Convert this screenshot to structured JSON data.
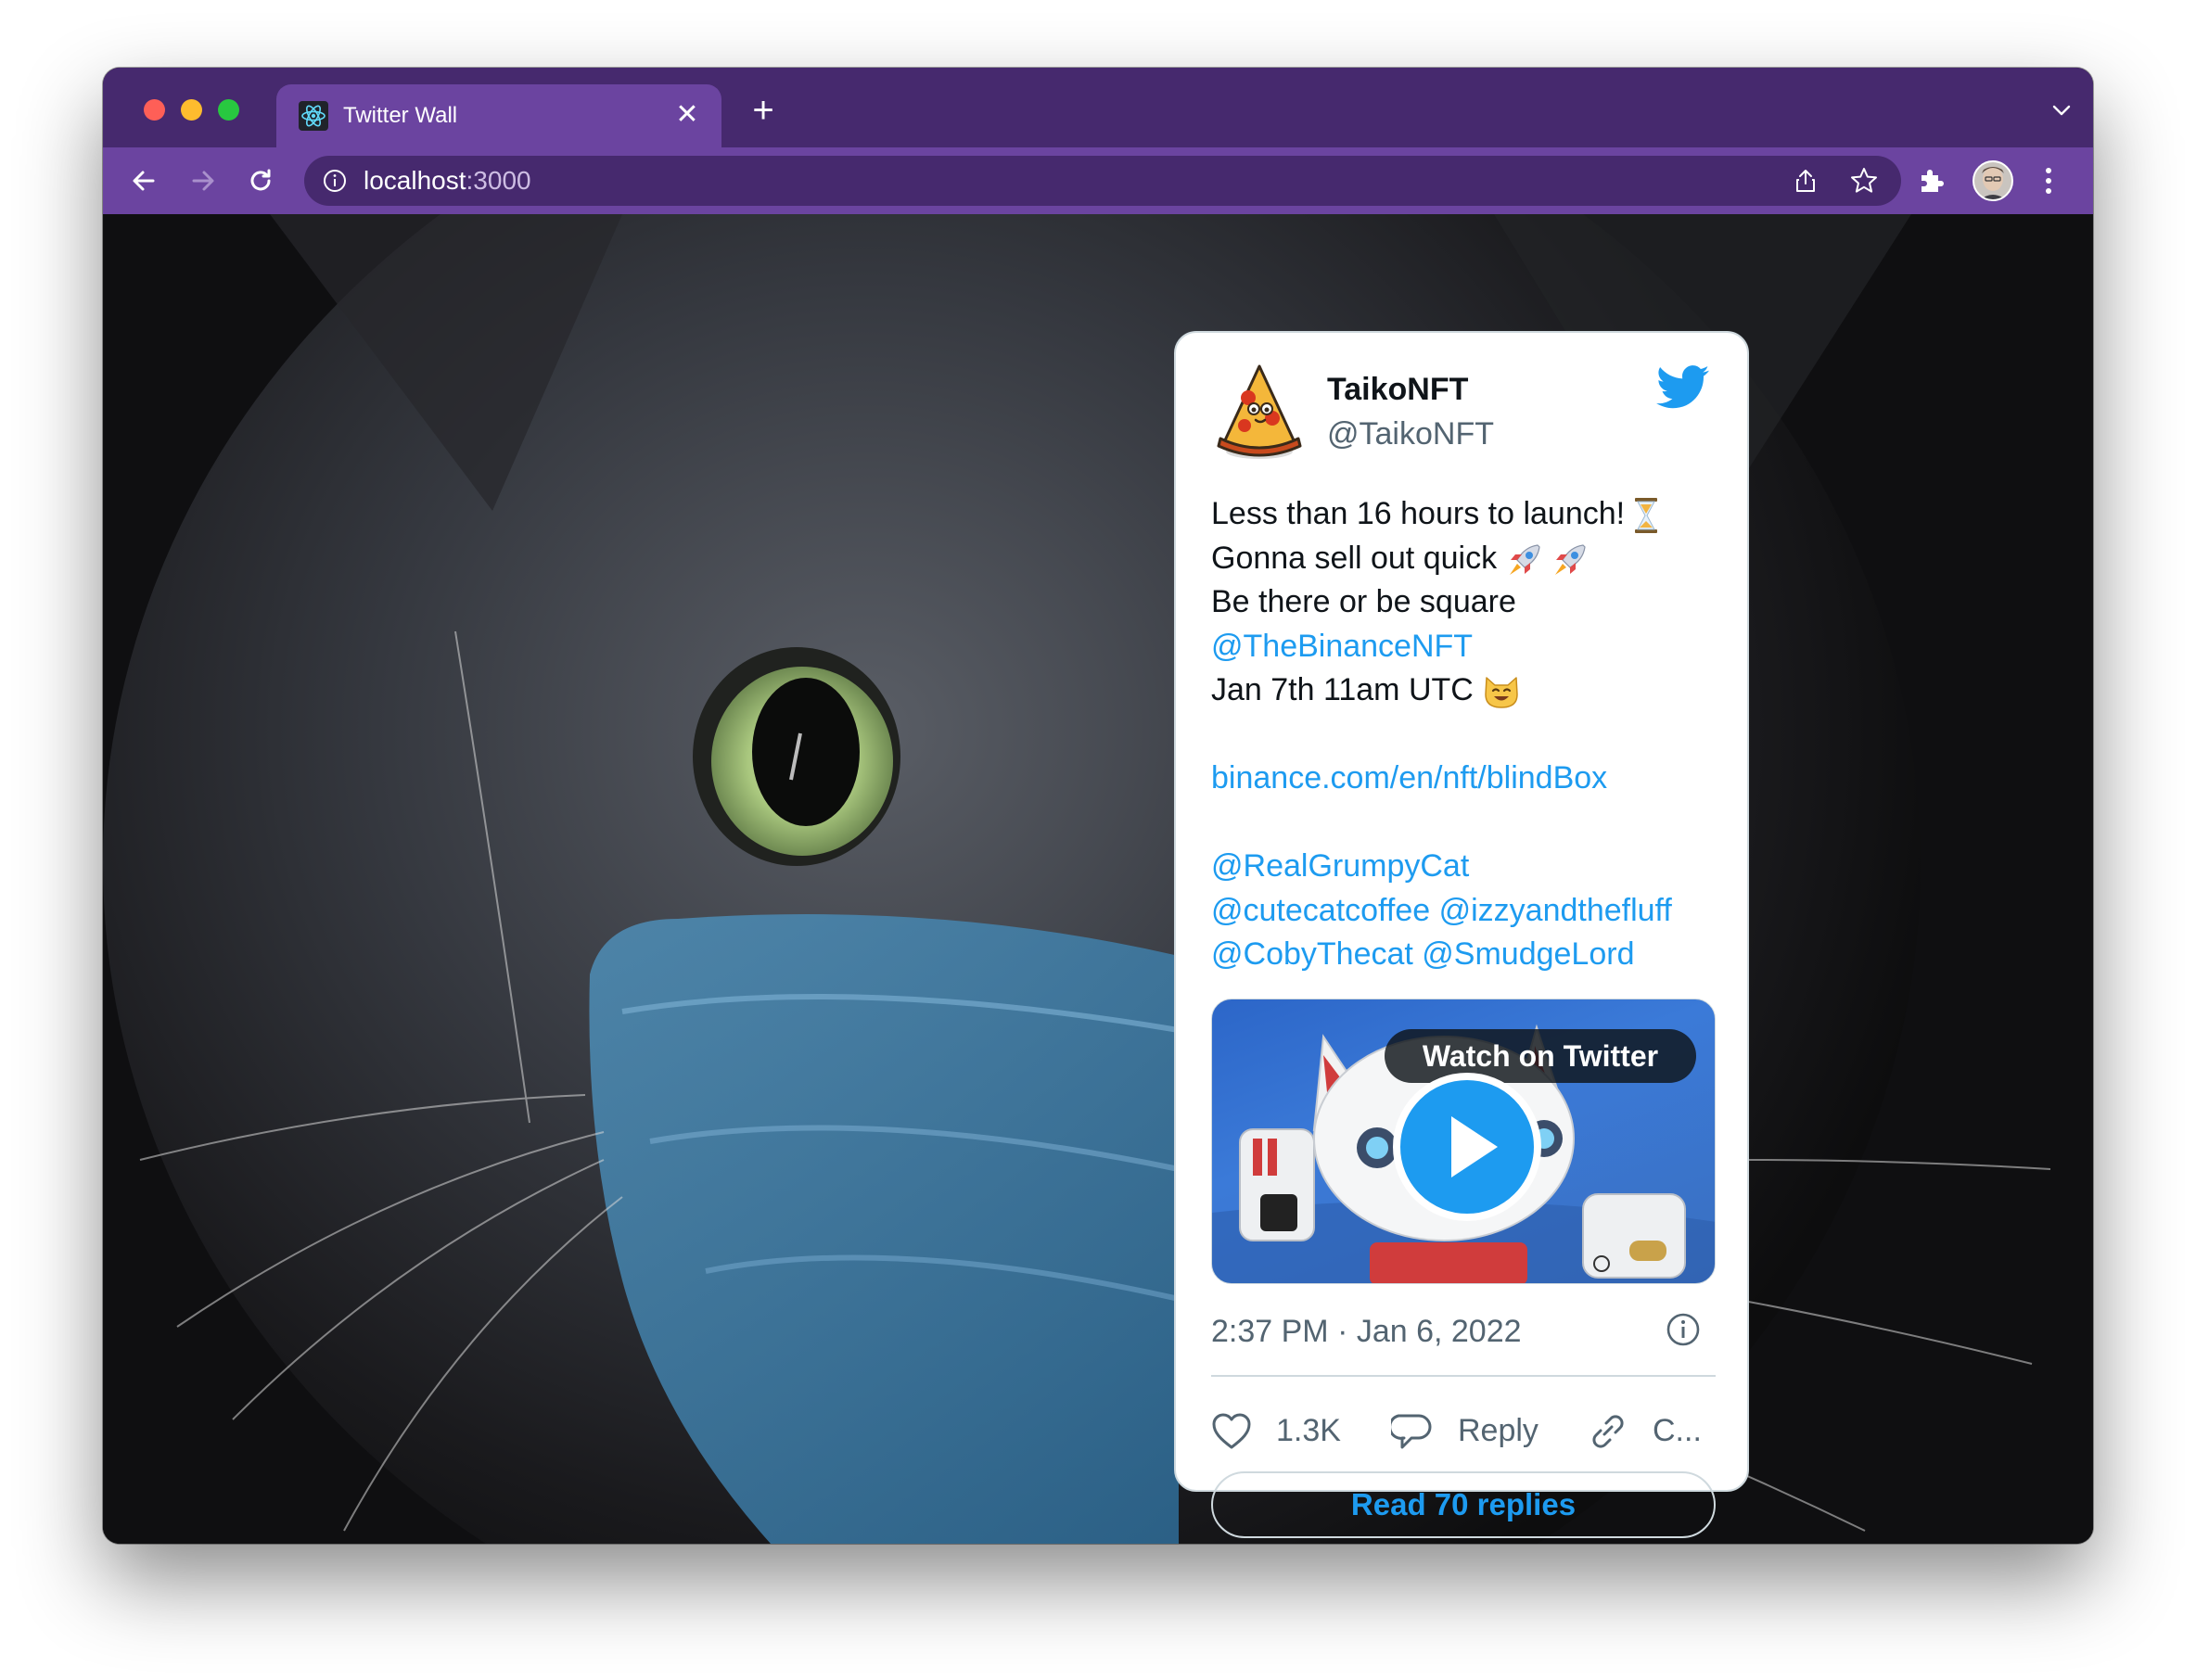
{
  "browser": {
    "tab_title": "Twitter Wall",
    "tab_close": "✕",
    "new_tab": "+",
    "url_host": "localhost",
    "url_port": ":3000"
  },
  "tweet": {
    "display_name": "TaikoNFT",
    "handle": "@TaikoNFT",
    "text_lines": [
      "Less than 16 hours to launch!",
      "Gonna sell out quick",
      "Be there or be square",
      "@TheBinanceNFT",
      "Jan 7th 11am UTC",
      "",
      "binance.com/en/nft/blindBox",
      "",
      "@RealGrumpyCat",
      "@cutecatcoffee @izzyandthefluff",
      "@CobyThecat @SmudgeLord"
    ],
    "emojis": [
      "hourglass-emoji",
      "rocket-emoji",
      "rocket-emoji",
      "smiling-cat-emoji"
    ],
    "media_overlay": "Watch on Twitter",
    "timestamp": "2:37 PM · Jan 6, 2022",
    "likes": "1.3K",
    "reply_label": "Reply",
    "copy_label": "C...",
    "read_replies": "Read 70 replies",
    "link_color": "#1d9bf0"
  },
  "colors": {
    "tabstrip": "#46296e",
    "toolbar": "#6b44a0"
  }
}
